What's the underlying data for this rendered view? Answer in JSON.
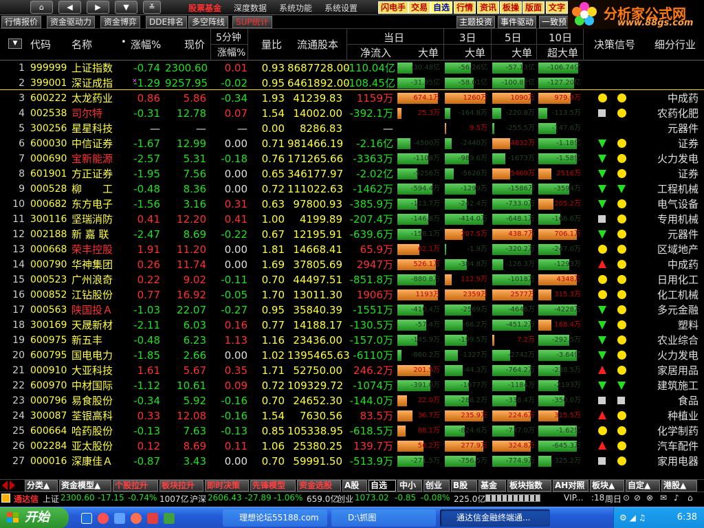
{
  "menubar": {
    "nav_buttons": [
      "home-icon",
      "arrow-left-icon",
      "arrow-right-icon",
      "arrow-down-icon",
      "double-chevron-down-icon"
    ],
    "menus": [
      "股票基金",
      "深度数据",
      "系统功能",
      "系统设置"
    ],
    "quick_buttons": [
      "闪电手",
      "交易",
      "自选",
      "行情",
      "资讯",
      "板操",
      "版面",
      "文字"
    ]
  },
  "logo": {
    "text": "分析家公式网",
    "url": "www.88gs.com"
  },
  "tabs": [
    "行情报价",
    "资金驱动力",
    "资金博弈",
    "DDE排名",
    "多空阵线",
    "SUP统计"
  ],
  "right_tabs": [
    "主题投资",
    "事件驱动",
    "一致预"
  ],
  "header": {
    "sort_icon": "sort-down-icon",
    "code": "代码",
    "name": "名称",
    "dot": "•",
    "chg": "涨幅%",
    "price": "现价",
    "f5_top": "5分钟",
    "f5_bot": "涨幅%",
    "vr": "量比",
    "cap": "流通股本",
    "today": "当日",
    "flow": "净流入",
    "big": "大单",
    "d3": "3日",
    "d3_big": "大单",
    "d5": "5日",
    "d5_big": "大单",
    "d10": "10日",
    "d10_big": "超大单",
    "signal": "决策信号",
    "industry": "细分行业"
  },
  "rows": [
    {
      "i": "1",
      "code": "999999",
      "name": "上证指数",
      "nc": "n",
      "chg": "-0.74",
      "price": "2300.60",
      "pc": "g",
      "f5": "0.01",
      "f5c": "r",
      "vr": "0.93",
      "cap": "8687728.00",
      "flow": "-110.04亿",
      "fc": "g",
      "b1": "-30.48亿",
      "b1v": 0.35,
      "b1c": "g",
      "b3": "-56.26亿",
      "b3v": 0.6,
      "b3c": "g",
      "b5": "-57.13亿",
      "b5v": 0.68,
      "b5c": "g",
      "b10": "-106.74亿",
      "b10v": 0.9,
      "b10c": "g",
      "s1": "",
      "s2": "",
      "ind": ""
    },
    {
      "i": "2",
      "code": "399001",
      "name": "深证成指",
      "nc": "n",
      "chg": "-1.29",
      "price": "9257.95",
      "pc": "g",
      "f5": "-0.02",
      "f5c": "g",
      "vr": "0.95",
      "cap": "6461892.00",
      "flow": "-108.45亿",
      "fc": "g",
      "b1": "-31.95亿",
      "b1v": 0.62,
      "b1c": "g",
      "b3": "-58.01亿",
      "b3v": 0.66,
      "b3c": "g",
      "b5": "-100.82亿",
      "b5v": 0.74,
      "b5c": "g",
      "b10": "-127.20亿",
      "b10v": 0.82,
      "b10c": "g",
      "s1": "",
      "s2": "",
      "ind": "",
      "mark": "×"
    },
    {
      "i": "3",
      "code": "600222",
      "name": "太龙药业",
      "nc": "n",
      "chg": "0.86",
      "price": "5.86",
      "pc": "r",
      "f5": "-0.34",
      "f5c": "g",
      "vr": "1.93",
      "cap": "41239.83",
      "flow": "1159万",
      "fc": "r",
      "b1": "674.1万",
      "b1v": 0.92,
      "b1c": "o",
      "b3": "1260万",
      "b3v": 0.92,
      "b3c": "o",
      "b5": "1090万",
      "b5v": 0.88,
      "b5c": "o",
      "b10": "979.9万",
      "b10v": 0.74,
      "b10c": "o",
      "s1": "dot",
      "s2": "dot",
      "ind": "中成药"
    },
    {
      "i": "4",
      "code": "002538",
      "name": "司尔特",
      "nc": "r",
      "chg": "-0.31",
      "price": "12.78",
      "pc": "g",
      "f5": "0.07",
      "f5c": "r",
      "vr": "1.54",
      "cap": "14002.00",
      "flow": "-392.1万",
      "fc": "g",
      "b1": "25.3万",
      "b1v": 0.1,
      "b1c": "o",
      "b3": "-164.8万",
      "b3v": 0.12,
      "b3c": "g",
      "b5": "-220.8万",
      "b5v": 0.2,
      "b5c": "g",
      "b10": "-113.5万",
      "b10v": 0.2,
      "b10c": "g",
      "s1": "sq",
      "s2": "dot",
      "ind": "农药化肥"
    },
    {
      "i": "5",
      "code": "300256",
      "name": "星星科技",
      "nc": "n",
      "chg": "—",
      "price": "—",
      "pc": "w",
      "f5": "—",
      "f5c": "w",
      "vr": "0.00",
      "cap": "8286.83",
      "flow": "—",
      "fc": "w",
      "b1": "",
      "b1v": 0,
      "b1c": "g",
      "b3": "9.5万",
      "b3v": 0.03,
      "b3c": "o",
      "b5": "-255.5万",
      "b5v": 0.05,
      "b5c": "g",
      "b10": "-147.6万",
      "b10v": 0.4,
      "b10c": "g",
      "s1": "",
      "s2": "",
      "ind": "元器件"
    },
    {
      "i": "6",
      "code": "600030",
      "name": "中信证券",
      "nc": "n",
      "chg": "-1.67",
      "price": "12.99",
      "pc": "g",
      "f5": "0.00",
      "f5c": "w",
      "vr": "0.71",
      "cap": "981466.19",
      "flow": "-2.16亿",
      "fc": "g",
      "b1": "-4500万",
      "b1v": 0.3,
      "b1c": "g",
      "b3": "-2440万",
      "b3v": 0.15,
      "b3c": "g",
      "b5": "4832万",
      "b5v": 0.4,
      "b5c": "o",
      "b10": "-1.18亿",
      "b10v": 0.88,
      "b10c": "g",
      "s1": "tdn",
      "s2": "dot",
      "ind": "证券"
    },
    {
      "i": "7",
      "code": "000690",
      "name": "宝新能源",
      "nc": "r",
      "chg": "-2.57",
      "price": "5.31",
      "pc": "g",
      "f5": "-0.18",
      "f5c": "g",
      "vr": "0.76",
      "cap": "171265.66",
      "flow": "-3363万",
      "fc": "g",
      "b1": "-1108万",
      "b1v": 0.7,
      "b1c": "g",
      "b3": "-989.6万",
      "b3v": 0.55,
      "b3c": "g",
      "b5": "-1673万",
      "b5v": 0.3,
      "b5c": "g",
      "b10": "-1.58亿",
      "b10v": 0.88,
      "b10c": "g",
      "s1": "tdn",
      "s2": "dot",
      "ind": "火力发电"
    },
    {
      "i": "8",
      "code": "601901",
      "name": "方正证券",
      "nc": "n",
      "chg": "-1.95",
      "price": "7.56",
      "pc": "g",
      "f5": "0.00",
      "f5c": "w",
      "vr": "0.65",
      "cap": "346177.97",
      "flow": "-2.02亿",
      "fc": "g",
      "b1": "-5256万",
      "b1v": 0.45,
      "b1c": "g",
      "b3": "-5626万",
      "b3v": 0.2,
      "b3c": "g",
      "b5": "5469万",
      "b5v": 0.4,
      "b5c": "o",
      "b10": "2516万",
      "b10v": 0.3,
      "b10c": "o",
      "s1": "tdn",
      "s2": "dot",
      "ind": "证券"
    },
    {
      "i": "9",
      "code": "000528",
      "name": "柳　　工",
      "nc": "n",
      "chg": "-0.48",
      "price": "8.36",
      "pc": "g",
      "f5": "0.00",
      "f5c": "w",
      "vr": "0.72",
      "cap": "111022.63",
      "flow": "-1462万",
      "fc": "g",
      "b1": "-594.4万",
      "b1v": 0.8,
      "b1c": "g",
      "b3": "-1299万",
      "b3v": 0.7,
      "b3c": "g",
      "b5": "-1586万",
      "b5v": 0.9,
      "b5c": "g",
      "b10": "-3594万",
      "b10v": 0.7,
      "b10c": "g",
      "s1": "tdn",
      "s2": "tdn",
      "ind": "工程机械"
    },
    {
      "i": "10",
      "code": "000682",
      "name": "东方电子",
      "nc": "n",
      "chg": "-1.56",
      "price": "3.16",
      "pc": "g",
      "f5": "0.31",
      "f5c": "r",
      "vr": "0.63",
      "cap": "97800.93",
      "flow": "-385.9万",
      "fc": "g",
      "b1": "-113.7万",
      "b1v": 0.45,
      "b1c": "g",
      "b3": "-242.4万",
      "b3v": 0.5,
      "b3c": "g",
      "b5": "-733.0万",
      "b5v": 0.88,
      "b5c": "g",
      "b10": "205.2万",
      "b10v": 0.35,
      "b10c": "o",
      "s1": "tdn",
      "s2": "dot",
      "ind": "电气设备"
    },
    {
      "i": "11",
      "code": "300116",
      "name": "坚瑞消防",
      "nc": "n",
      "chg": "0.41",
      "price": "12.20",
      "pc": "r",
      "f5": "0.41",
      "f5c": "r",
      "vr": "1.00",
      "cap": "4199.89",
      "flow": "-207.4万",
      "fc": "g",
      "b1": "-146.8万",
      "b1v": 0.7,
      "b1c": "g",
      "b3": "-414.0万",
      "b3v": 0.88,
      "b3c": "g",
      "b5": "-648.1万",
      "b5v": 0.88,
      "b5c": "g",
      "b10": "-166.6万",
      "b10v": 0.5,
      "b10c": "g",
      "s1": "sq",
      "s2": "dot",
      "ind": "专用机械"
    },
    {
      "i": "12",
      "code": "002188",
      "name": "新 嘉 联",
      "nc": "n",
      "chg": "-2.47",
      "price": "8.69",
      "pc": "g",
      "f5": "-0.22",
      "f5c": "g",
      "vr": "0.67",
      "cap": "12195.91",
      "flow": "-639.6万",
      "fc": "g",
      "b1": "-158.1万",
      "b1v": 0.55,
      "b1c": "g",
      "b3": "207.5万",
      "b3v": 0.4,
      "b3c": "o",
      "b5": "438.7万",
      "b5v": 0.9,
      "b5c": "o",
      "b10": "706.1万",
      "b10v": 0.88,
      "b10c": "o",
      "s1": "tdn",
      "s2": "dot",
      "ind": "元器件"
    },
    {
      "i": "13",
      "code": "000668",
      "name": "荣丰控股",
      "nc": "r",
      "chg": "1.91",
      "price": "11.20",
      "pc": "r",
      "f5": "0.00",
      "f5c": "w",
      "vr": "1.81",
      "cap": "14668.41",
      "flow": "65.9万",
      "fc": "r",
      "b1": "62.1万",
      "b1v": 0.5,
      "b1c": "o",
      "b3": "-1.9万",
      "b3v": 0.03,
      "b3c": "g",
      "b5": "-320.2万",
      "b5v": 0.88,
      "b5c": "g",
      "b10": "-247.0万",
      "b10v": 0.5,
      "b10c": "g",
      "s1": "dot",
      "s2": "dot",
      "ind": "区域地产"
    },
    {
      "i": "14",
      "code": "000790",
      "name": "华神集团",
      "nc": "n",
      "chg": "0.26",
      "price": "11.74",
      "pc": "r",
      "f5": "0.00",
      "f5c": "w",
      "vr": "1.69",
      "cap": "37805.69",
      "flow": "2947万",
      "fc": "r",
      "b1": "526.1万",
      "b1v": 0.88,
      "b1c": "o",
      "b3": "-384.8万",
      "b3v": 0.5,
      "b3c": "g",
      "b5": "-126.3万",
      "b5v": 0.25,
      "b5c": "g",
      "b10": "-1293万",
      "b10v": 0.7,
      "b10c": "g",
      "s1": "tup",
      "s2": "dot",
      "ind": "中成药"
    },
    {
      "i": "15",
      "code": "000523",
      "name": "广州浪奇",
      "nc": "n",
      "chg": "0.22",
      "price": "9.02",
      "pc": "r",
      "f5": "-0.11",
      "f5c": "g",
      "vr": "0.70",
      "cap": "44497.51",
      "flow": "-851.8万",
      "fc": "g",
      "b1": "-880.8万",
      "b1v": 0.88,
      "b1c": "g",
      "b3": "112.9万",
      "b3v": 0.15,
      "b3c": "o",
      "b5": "-1018万",
      "b5v": 0.88,
      "b5c": "g",
      "b10": "4348万",
      "b10v": 0.88,
      "b10c": "o",
      "s1": "dot",
      "s2": "dot",
      "ind": "日用化工"
    },
    {
      "i": "16",
      "code": "000852",
      "name": "江钻股份",
      "nc": "n",
      "chg": "0.77",
      "price": "16.92",
      "pc": "r",
      "f5": "-0.05",
      "f5c": "g",
      "vr": "1.70",
      "cap": "13011.30",
      "flow": "1906万",
      "fc": "r",
      "b1": "1193万",
      "b1v": 0.92,
      "b1c": "o",
      "b3": "2359万",
      "b3v": 0.92,
      "b3c": "o",
      "b5": "2577万",
      "b5v": 0.92,
      "b5c": "o",
      "b10": "315.3万",
      "b10v": 0.3,
      "b10c": "o",
      "s1": "dot",
      "s2": "dot",
      "ind": "化工机械"
    },
    {
      "i": "17",
      "code": "000563",
      "name": "陕国投Ａ",
      "nc": "r",
      "chg": "-1.03",
      "price": "22.07",
      "pc": "g",
      "f5": "-0.27",
      "f5c": "g",
      "vr": "0.95",
      "cap": "35840.39",
      "flow": "-1551万",
      "fc": "g",
      "b1": "-410.4万",
      "b1v": 0.6,
      "b1c": "g",
      "b3": "-2569万",
      "b3v": 0.6,
      "b3c": "g",
      "b5": "-4646万",
      "b5v": 0.7,
      "b5c": "g",
      "b10": "-4228万",
      "b10v": 0.88,
      "b10c": "g",
      "s1": "tdn",
      "s2": "dot",
      "ind": "多元金融"
    },
    {
      "i": "18",
      "code": "300169",
      "name": "天晟新材",
      "nc": "n",
      "chg": "-2.11",
      "price": "6.03",
      "pc": "g",
      "f5": "0.16",
      "f5c": "r",
      "vr": "0.77",
      "cap": "14188.17",
      "flow": "-130.5万",
      "fc": "g",
      "b1": "-57.4万",
      "b1v": 0.65,
      "b1c": "g",
      "b3": "-66.2万",
      "b3v": 0.4,
      "b3c": "g",
      "b5": "-451.2万",
      "b5v": 0.88,
      "b5c": "g",
      "b10": "168.4万",
      "b10v": 0.3,
      "b10c": "o",
      "s1": "tdn",
      "s2": "dot",
      "ind": "塑料"
    },
    {
      "i": "19",
      "code": "600975",
      "name": "新五丰",
      "nc": "n",
      "chg": "-0.48",
      "price": "6.23",
      "pc": "g",
      "f5": "1.13",
      "f5c": "r",
      "vr": "1.16",
      "cap": "23436.00",
      "flow": "-157.0万",
      "fc": "g",
      "b1": "-145.9万",
      "b1v": 0.45,
      "b1c": "g",
      "b3": "-199.5万",
      "b3v": 0.5,
      "b3c": "g",
      "b5": "7.2万",
      "b5v": 0.04,
      "b5c": "o",
      "b10": "-292.5万",
      "b10v": 0.7,
      "b10c": "g",
      "s1": "tdn",
      "s2": "dot",
      "ind": "农业综合"
    },
    {
      "i": "20",
      "code": "600795",
      "name": "国电电力",
      "nc": "n",
      "chg": "-1.85",
      "price": "2.66",
      "pc": "g",
      "f5": "0.00",
      "f5c": "w",
      "vr": "1.02",
      "cap": "1395465.63",
      "flow": "-6110万",
      "fc": "g",
      "b1": "-860.2万",
      "b1v": 0.1,
      "b1c": "g",
      "b3": "-1327万",
      "b3v": 0.3,
      "b3c": "g",
      "b5": "-2742万",
      "b5v": 0.4,
      "b5c": "g",
      "b10": "-3.64亿",
      "b10v": 0.88,
      "b10c": "g",
      "s1": "tdn",
      "s2": "dot",
      "ind": "火力发电"
    },
    {
      "i": "21",
      "code": "000910",
      "name": "大亚科技",
      "nc": "n",
      "chg": "1.61",
      "price": "5.67",
      "pc": "r",
      "f5": "0.35",
      "f5c": "r",
      "vr": "1.71",
      "cap": "52750.00",
      "flow": "246.2万",
      "fc": "r",
      "b1": "201.5万",
      "b1v": 0.75,
      "b1c": "o",
      "b3": "-44.3万",
      "b3v": 0.4,
      "b3c": "g",
      "b5": "-764.2万",
      "b5v": 0.88,
      "b5c": "g",
      "b10": "-238.5万",
      "b10v": 0.5,
      "b10c": "g",
      "s1": "tup",
      "s2": "dot",
      "ind": "家居用品"
    },
    {
      "i": "22",
      "code": "600970",
      "name": "中材国际",
      "nc": "n",
      "chg": "-1.12",
      "price": "10.61",
      "pc": "g",
      "f5": "0.09",
      "f5c": "r",
      "vr": "0.72",
      "cap": "109329.72",
      "flow": "-1074万",
      "fc": "g",
      "b1": "-391.0万",
      "b1v": 0.75,
      "b1c": "g",
      "b3": "-1077万",
      "b3v": 0.55,
      "b3c": "g",
      "b5": "-1184万",
      "b5v": 0.75,
      "b5c": "g",
      "b10": "-2193万",
      "b10v": 0.45,
      "b10c": "g",
      "s1": "tdn",
      "s2": "tdn",
      "ind": "建筑施工"
    },
    {
      "i": "23",
      "code": "000796",
      "name": "易食股份",
      "nc": "n",
      "chg": "-0.34",
      "price": "5.92",
      "pc": "g",
      "f5": "-0.16",
      "f5c": "g",
      "vr": "0.70",
      "cap": "24652.30",
      "flow": "-144.0万",
      "fc": "g",
      "b1": "22.0万",
      "b1v": 0.22,
      "b1c": "o",
      "b3": "-286.2万",
      "b3v": 0.55,
      "b3c": "g",
      "b5": "-338.4万",
      "b5v": 0.55,
      "b5c": "g",
      "b10": "-350.0万",
      "b10v": 0.6,
      "b10c": "g",
      "s1": "sq",
      "s2": "sq",
      "ind": "食品"
    },
    {
      "i": "24",
      "code": "300087",
      "name": "荃银高科",
      "nc": "n",
      "chg": "0.33",
      "price": "12.08",
      "pc": "r",
      "f5": "-0.16",
      "f5c": "g",
      "vr": "1.54",
      "cap": "7630.56",
      "flow": "83.5万",
      "fc": "r",
      "b1": "36.7万",
      "b1v": 0.35,
      "b1c": "o",
      "b3": "235.9万",
      "b3v": 0.88,
      "b3c": "o",
      "b5": "224.6万",
      "b5v": 0.88,
      "b5c": "o",
      "b10": "315.5万",
      "b10v": 0.45,
      "b10c": "o",
      "s1": "tup",
      "s2": "dot",
      "ind": "种植业"
    },
    {
      "i": "25",
      "code": "600664",
      "name": "哈药股份",
      "nc": "n",
      "chg": "-0.13",
      "price": "7.63",
      "pc": "g",
      "f5": "-0.13",
      "f5c": "g",
      "vr": "0.85",
      "cap": "105338.95",
      "flow": "-618.5万",
      "fc": "g",
      "b1": "88.1万",
      "b1v": 0.18,
      "b1c": "o",
      "b3": "-824.6万",
      "b3v": 0.45,
      "b3c": "g",
      "b5": "-737.0万",
      "b5v": 0.5,
      "b5c": "g",
      "b10": "-1.62亿",
      "b10v": 0.88,
      "b10c": "g",
      "s1": "dot",
      "s2": "dot",
      "ind": "化学制药"
    },
    {
      "i": "26",
      "code": "002284",
      "name": "亚太股份",
      "nc": "n",
      "chg": "0.12",
      "price": "8.69",
      "pc": "r",
      "f5": "0.11",
      "f5c": "r",
      "vr": "1.06",
      "cap": "25380.25",
      "flow": "139.7万",
      "fc": "r",
      "b1": "56.2万",
      "b1v": 0.6,
      "b1c": "o",
      "b3": "277.9万",
      "b3v": 0.88,
      "b3c": "o",
      "b5": "324.8万",
      "b5v": 0.88,
      "b5c": "o",
      "b10": "-645.3万",
      "b10v": 0.88,
      "b10c": "g",
      "s1": "tup",
      "s2": "dot",
      "ind": "汽车配件"
    },
    {
      "i": "27",
      "code": "000016",
      "name": "深康佳Ａ",
      "nc": "n",
      "chg": "-0.87",
      "price": "3.43",
      "pc": "g",
      "f5": "0.00",
      "f5c": "w",
      "vr": "0.70",
      "cap": "59991.50",
      "flow": "-513.9万",
      "fc": "g",
      "b1": "-271.5万",
      "b1v": 0.6,
      "b1c": "g",
      "b3": "-756.5万",
      "b3v": 0.7,
      "b3c": "g",
      "b5": "-774.9万",
      "b5v": 0.88,
      "b5c": "g",
      "b10": "-325.2万",
      "b10v": 0.3,
      "b10c": "g",
      "s1": "sq",
      "s2": "dot",
      "ind": "家用电器"
    }
  ],
  "cat_tabs": [
    "分类▲",
    "资金模型▲",
    "个股拉升",
    "板块拉升",
    "即时决策",
    "先锋模型",
    "资金选股",
    "A股",
    "自选",
    "中小",
    "创业",
    "B股",
    "基金",
    "板块指数",
    "AH对照",
    "板块▲",
    "自定▲",
    "港股▲"
  ],
  "index_bar": {
    "brand": "通达信",
    "sh_label": "上证",
    "sh_val": "2300.60",
    "sh_chg": "-17.15",
    "sh_pct": "-0.74%",
    "sh_amt": "1007亿",
    "sz_label": "沪深",
    "sz_val": "2606.43",
    "sz_chg": "-27.89",
    "sz_pct": "-1.06%",
    "sz_amt": "659.0亿",
    "cy_label": "创业",
    "cy_val": "1073.02",
    "cy_chg": "-0.85",
    "cy_pct": "-0.08%",
    "cy_amt": "225.0亿",
    "vip": "VIP...",
    "time": ":18",
    "week": "周日"
  },
  "taskbar": {
    "start": "开始",
    "tasks": [
      "理想论坛55188.com",
      "D:\\抓图",
      "通达信金融终端通..."
    ],
    "clock": "6:38"
  },
  "colors": {
    "up": "#ff3030",
    "down": "#20e020",
    "code": "#ffff40",
    "bar_green": "#3caf3c",
    "bar_orange": "#e88a30"
  }
}
